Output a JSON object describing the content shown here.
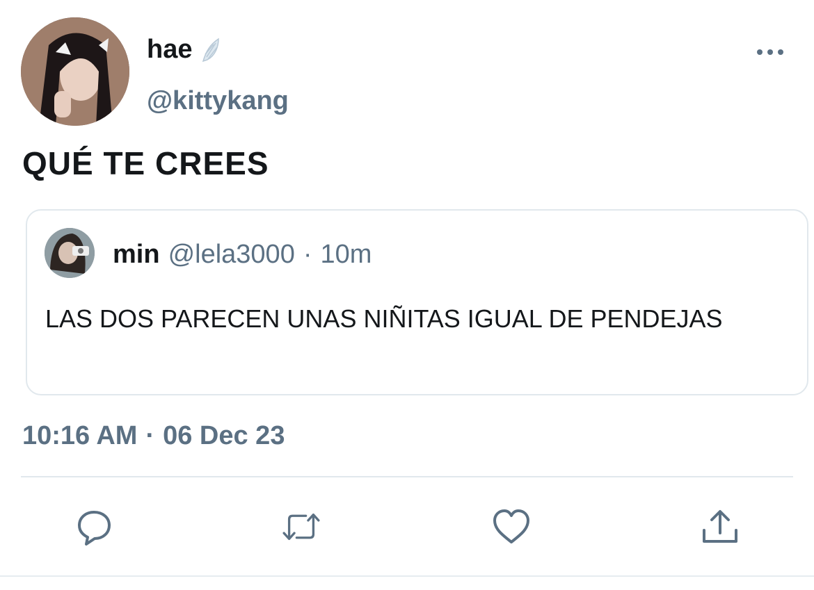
{
  "author": {
    "display_name": "hae",
    "handle": "@kittykang"
  },
  "tweet": {
    "text": "QUÉ TE CREES",
    "time": "10:16 AM",
    "separator": "·",
    "date": "06 Dec 23"
  },
  "quote": {
    "name": "min",
    "handle": "@lela3000",
    "separator": "·",
    "time": "10m",
    "text": "LAS DOS PARECEN UNAS NIÑITAS IGUAL DE PENDEJAS"
  },
  "colors": {
    "primary_text": "#14171a",
    "secondary_text": "#5b7083",
    "border": "#e1e8ed"
  },
  "icons": {
    "more": "more-horizontal-icon",
    "verified_like": "wing-icon",
    "reply": "reply-icon",
    "retweet": "retweet-icon",
    "like": "heart-icon",
    "share": "share-icon"
  }
}
